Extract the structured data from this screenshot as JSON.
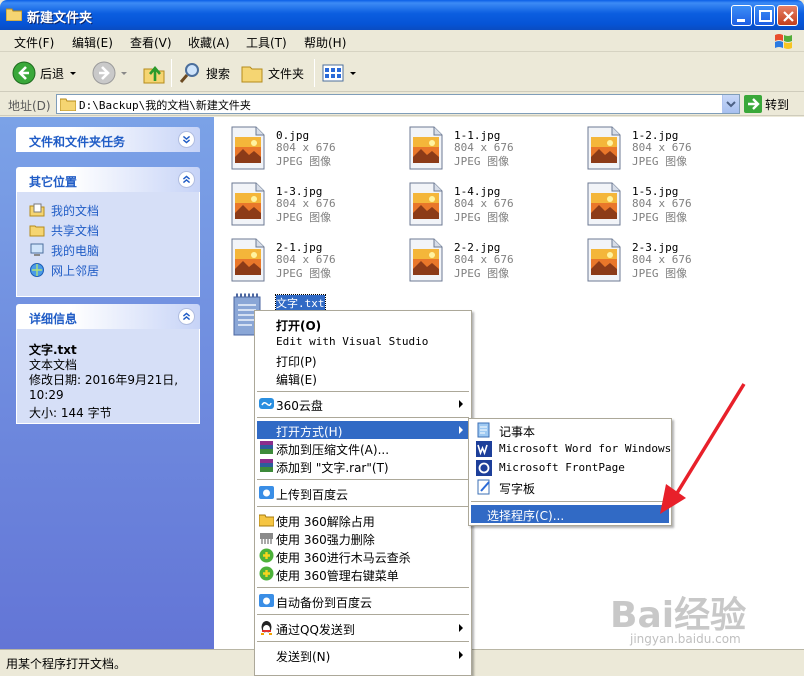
{
  "window": {
    "title": "新建文件夹"
  },
  "menu": [
    "文件(F)",
    "编辑(E)",
    "查看(V)",
    "收藏(A)",
    "工具(T)",
    "帮助(H)"
  ],
  "toolbar": {
    "back": "后退",
    "search": "搜索",
    "folders": "文件夹"
  },
  "address": {
    "label": "地址(D)",
    "path": "D:\\Backup\\我的文档\\新建文件夹",
    "go": "转到"
  },
  "tasks": {
    "file_tasks_title": "文件和文件夹任务",
    "other_places_title": "其它位置",
    "other_places": [
      "我的文档",
      "共享文档",
      "我的电脑",
      "网上邻居"
    ],
    "details_title": "详细信息",
    "details": {
      "name": "文字.txt",
      "type": "文本文档",
      "modified": "修改日期: 2016年9月21日, 10:29",
      "size": "大小: 144 字节"
    }
  },
  "files": [
    {
      "name": "0.jpg",
      "size": "804 x 676",
      "type": "JPEG 图像"
    },
    {
      "name": "1-1.jpg",
      "size": "804 x 676",
      "type": "JPEG 图像"
    },
    {
      "name": "1-2.jpg",
      "size": "804 x 676",
      "type": "JPEG 图像"
    },
    {
      "name": "1-3.jpg",
      "size": "804 x 676",
      "type": "JPEG 图像"
    },
    {
      "name": "1-4.jpg",
      "size": "804 x 676",
      "type": "JPEG 图像"
    },
    {
      "name": "1-5.jpg",
      "size": "804 x 676",
      "type": "JPEG 图像"
    },
    {
      "name": "2-1.jpg",
      "size": "804 x 676",
      "type": "JPEG 图像"
    },
    {
      "name": "2-2.jpg",
      "size": "804 x 676",
      "type": "JPEG 图像"
    },
    {
      "name": "2-3.jpg",
      "size": "804 x 676",
      "type": "JPEG 图像"
    }
  ],
  "selected_file": {
    "name": "文字.txt"
  },
  "context_menu": {
    "open": "打开(O)",
    "edit_vs": "Edit with Visual Studio",
    "print": "打印(P)",
    "edit": "编辑(E)",
    "cloud360": "360云盘",
    "open_with": "打开方式(H)",
    "add_archive": "添加到压缩文件(A)...",
    "add_rar": "添加到 \"文字.rar\"(T)",
    "upload_baidu": "上传到百度云",
    "unlock360": "使用 360解除占用",
    "delete360": "使用 360强力删除",
    "scan360": "使用 360进行木马云查杀",
    "manage360": "使用 360管理右键菜单",
    "backup_baidu": "自动备份到百度云",
    "send_qq": "通过QQ发送到",
    "send_to": "发送到(N)"
  },
  "submenu": {
    "notepad": "记事本",
    "word": "Microsoft Word for Windows",
    "frontpage": "Microsoft FrontPage",
    "wordpad": "写字板",
    "choose": "选择程序(C)..."
  },
  "status": {
    "text": "用某个程序打开文档。"
  },
  "watermark": {
    "logo": "Bai经验",
    "sub": "jingyan.baidu.com"
  },
  "colors": {
    "selection": "#316ac5",
    "link": "#215dc6",
    "titlebar": "#0b5ee0",
    "arrow": "#e8202a"
  }
}
